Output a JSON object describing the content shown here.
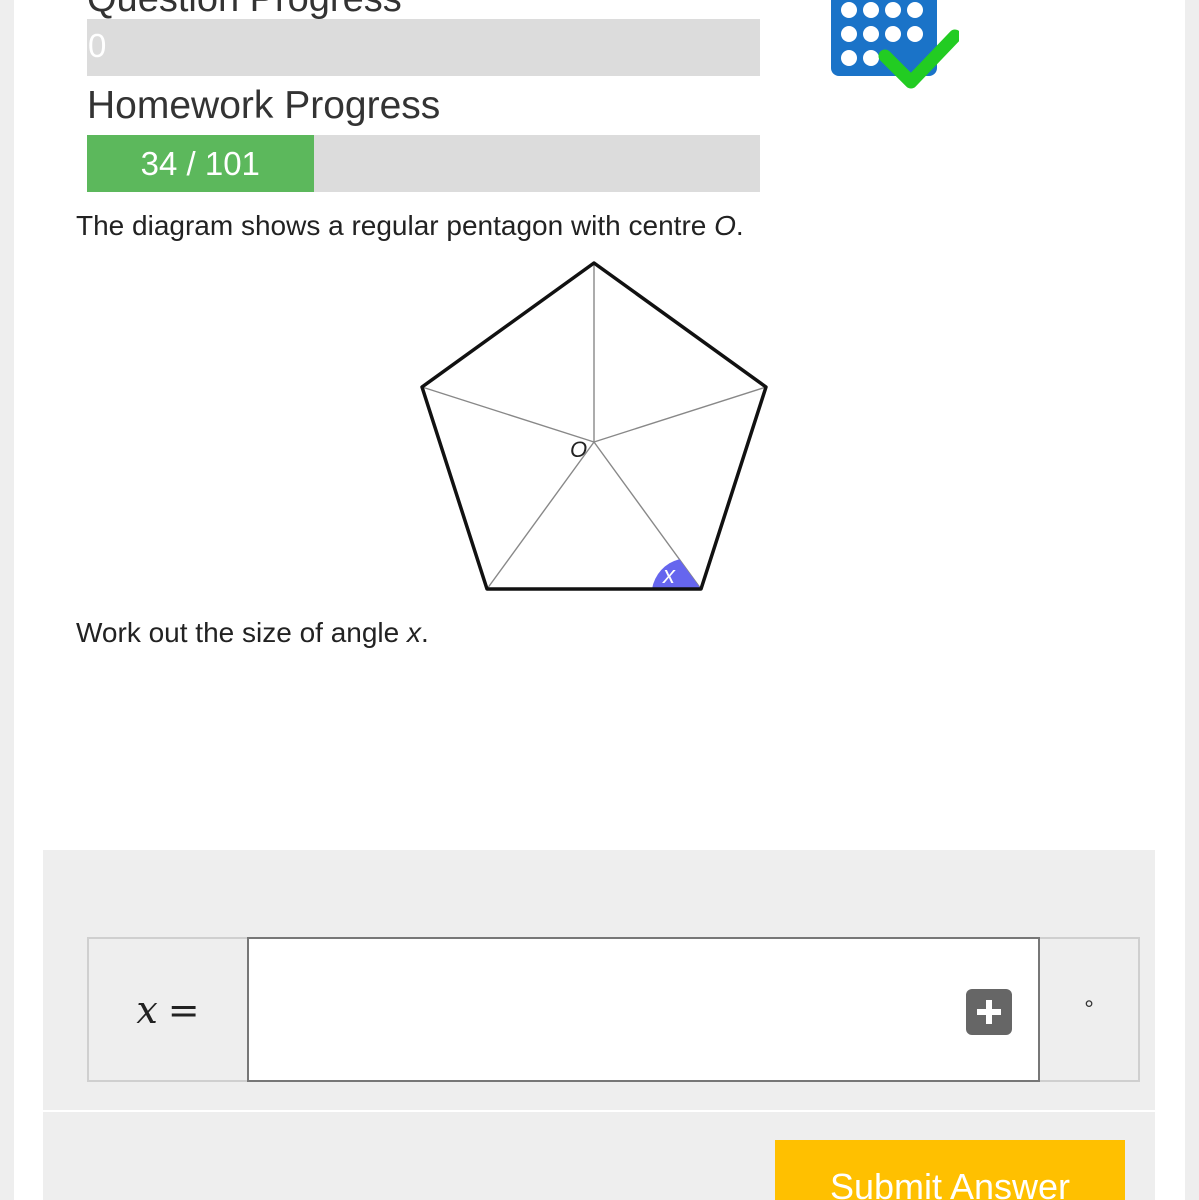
{
  "question_progress": {
    "label": "Question Progress",
    "value_text": "0",
    "fraction": 0
  },
  "homework_progress": {
    "label": "Homework Progress",
    "value_text": "34 / 101",
    "fraction": 0.3366
  },
  "question": {
    "intro_prefix": "The diagram shows a regular pentagon with centre ",
    "intro_var": "O",
    "intro_suffix": ".",
    "diagram_center_label": "O",
    "diagram_angle_label": "x",
    "task_prefix": "Work out the size of angle ",
    "task_var": "x",
    "task_suffix": "."
  },
  "answer": {
    "variable": "x",
    "equals": "=",
    "value": "",
    "unit": "°"
  },
  "submit": {
    "label": "Submit Answer"
  },
  "colors": {
    "progress_fill": "#5cb85c",
    "progress_track": "#dcdcdc",
    "angle_fill": "#6666ee",
    "submit_bg": "#ffc000",
    "logo_blue": "#1a73c8",
    "check_green": "#22cc22"
  },
  "icons": [
    "abacus-logo-icon",
    "checkmark-icon",
    "plus-icon"
  ]
}
